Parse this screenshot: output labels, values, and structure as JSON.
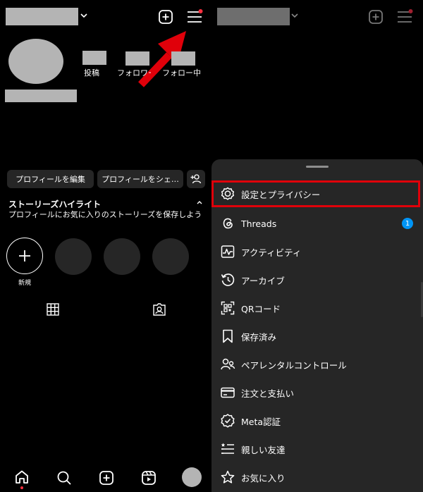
{
  "profile": {
    "stats": [
      {
        "label": "投稿"
      },
      {
        "label": "フォロワー"
      },
      {
        "label": "フォロー中"
      }
    ],
    "buttons": {
      "edit_profile": "プロフィールを編集",
      "share_profile": "プロフィールをシェ…"
    },
    "highlights": {
      "title": "ストーリーズハイライト",
      "description": "プロフィールにお気に入りのストーリーズを保存しよう",
      "new_label": "新規"
    }
  },
  "menu": {
    "items": [
      {
        "label": "設定とプライバシー",
        "icon": "settings-gear-icon",
        "highlighted": true
      },
      {
        "label": "Threads",
        "icon": "threads-icon",
        "badge": "1"
      },
      {
        "label": "アクティビティ",
        "icon": "activity-icon"
      },
      {
        "label": "アーカイブ",
        "icon": "archive-icon"
      },
      {
        "label": "QRコード",
        "icon": "qr-code-icon"
      },
      {
        "label": "保存済み",
        "icon": "bookmark-icon"
      },
      {
        "label": "ペアレンタルコントロール",
        "icon": "parental-control-icon"
      },
      {
        "label": "注文と支払い",
        "icon": "credit-card-icon"
      },
      {
        "label": "Meta認証",
        "icon": "verified-badge-icon"
      },
      {
        "label": "親しい友達",
        "icon": "close-friends-icon"
      },
      {
        "label": "お気に入り",
        "icon": "star-icon"
      }
    ]
  },
  "colors": {
    "background": "#000000",
    "sheet": "#262626",
    "button": "#262626",
    "highlight_box": "#e0000a",
    "badge": "#0095f6",
    "notification_dot": "#ff3040",
    "redacted": "#b4b4b4"
  }
}
